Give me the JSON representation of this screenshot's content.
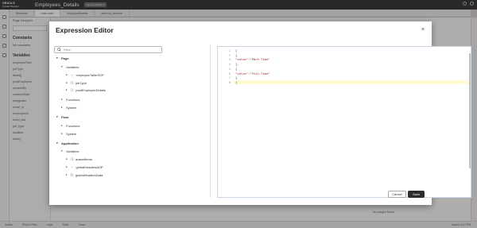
{
  "app": {
    "logo_line1": "ORACLE",
    "logo_line2": "Visual Builder",
    "title": "Employees_Details",
    "badge": "DEVELOPMENT"
  },
  "tabs": [
    {
      "label": "Welcome"
    },
    {
      "label": "main-start"
    },
    {
      "label": "EmployeeDetails"
    },
    {
      "label": "add-hist_scheme"
    }
  ],
  "background": {
    "page_designer": "Page Designer",
    "filter_placeholder": "Filter",
    "constants": "Constants",
    "no_constants": "No constants",
    "variables": "Variables",
    "items": [
      "employeeTabl",
      "jobType",
      "items[]",
      "postEmployee",
      "createdBy",
      "creationDate",
      "designatio",
      "email_id",
      "employeeId",
      "hired_dat",
      "job_type",
      "location",
      "salary"
    ],
    "create1": "Create",
    "create2": "Create",
    "no_usages": "No usages found"
  },
  "status": {
    "items": [
      "Audits",
      "Find in Files",
      "Logs",
      "Tests",
      "Trace"
    ],
    "saved": "Saved 2:12 PM"
  },
  "dialog": {
    "title": "Expression Editor",
    "close": "×",
    "filter_placeholder": "Filter",
    "tree": [
      {
        "label": "Page",
        "section": true,
        "twisty": "▾",
        "icon": ""
      },
      {
        "label": "Variables",
        "twisty": "▾",
        "icon": ""
      },
      {
        "label": "employeeTableSDP",
        "twisty": "▸",
        "icon": "↔"
      },
      {
        "label": "jobType",
        "twisty": "▸",
        "icon": "[ ]"
      },
      {
        "label": "postEmployeeDetails",
        "twisty": "▸",
        "icon": "{ }"
      },
      {
        "label": "Functions",
        "twisty": "▸",
        "icon": ""
      },
      {
        "label": "System",
        "twisty": "▸",
        "icon": ""
      },
      {
        "label": "Flow",
        "section": true,
        "twisty": "▾",
        "icon": ""
      },
      {
        "label": "Functions",
        "twisty": "▸",
        "icon": ""
      },
      {
        "label": "System",
        "twisty": "▸",
        "icon": ""
      },
      {
        "label": "Application",
        "section": true,
        "twisty": "▾",
        "icon": ""
      },
      {
        "label": "Variables",
        "twisty": "▾",
        "icon": ""
      },
      {
        "label": "avatarItems",
        "twisty": "▸",
        "icon": "[ ]"
      },
      {
        "label": "globalHeadersADP",
        "twisty": "▸",
        "icon": "↔"
      },
      {
        "label": "globalHeadersData",
        "twisty": "▸",
        "icon": "[ ]"
      }
    ],
    "code_lines": [
      {
        "n": "1",
        "text": "[",
        "str": false
      },
      {
        "n": "2",
        "text": "{",
        "str": false
      },
      {
        "n": "3",
        "text": "\"value\":\"Part-Time\"",
        "str": true
      },
      {
        "n": "4",
        "text": "},",
        "str": false
      },
      {
        "n": "5",
        "text": "{",
        "str": false
      },
      {
        "n": "6",
        "text": "\"value\":\"Full-Time\"",
        "str": true
      },
      {
        "n": "7",
        "text": "}",
        "str": false
      },
      {
        "n": "8",
        "text": "]",
        "str": false
      }
    ],
    "cancel": "Cancel",
    "save": "Save"
  }
}
